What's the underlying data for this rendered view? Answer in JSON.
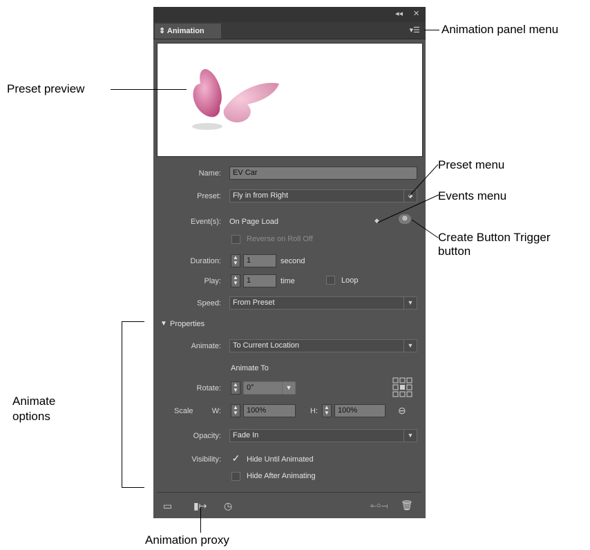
{
  "panel": {
    "tab_label": "Animation",
    "collapse_icon": "double-left-arrow",
    "close_icon": "x",
    "menu_icon": "panel-menu"
  },
  "form": {
    "name_label": "Name:",
    "name_value": "EV Car",
    "preset_label": "Preset:",
    "preset_value": "Fly in from Right",
    "events_label": "Event(s):",
    "events_value": "On Page Load",
    "reverse_label": "Reverse on Roll Off",
    "duration_label": "Duration:",
    "duration_value": "1",
    "duration_unit": "second",
    "play_label": "Play:",
    "play_value": "1",
    "play_unit": "time",
    "loop_label": "Loop",
    "speed_label": "Speed:",
    "speed_value": "From Preset"
  },
  "properties": {
    "header": "Properties",
    "animate_label": "Animate:",
    "animate_value": "To Current Location",
    "animate_to_label": "Animate To",
    "rotate_label": "Rotate:",
    "rotate_value": "0°",
    "scale_label": "Scale",
    "w_label": "W:",
    "w_value": "100%",
    "h_label": "H:",
    "h_value": "100%",
    "opacity_label": "Opacity:",
    "opacity_value": "Fade In",
    "visibility_label": "Visibility:",
    "hide_until_label": "Hide Until Animated",
    "hide_until_checked": true,
    "hide_after_label": "Hide After Animating",
    "hide_after_checked": false
  },
  "callouts": {
    "panel_menu": "Animation panel menu",
    "preset_preview": "Preset preview",
    "preset_menu": "Preset menu",
    "events_menu": "Events menu",
    "create_button_trigger_1": "Create Button Trigger",
    "create_button_trigger_2": "button",
    "animate_options_1": "Animate",
    "animate_options_2": "options",
    "animation_proxy": "Animation proxy"
  },
  "colors": {
    "panel_bg": "#535353",
    "butterfly": "#e07aa6"
  }
}
